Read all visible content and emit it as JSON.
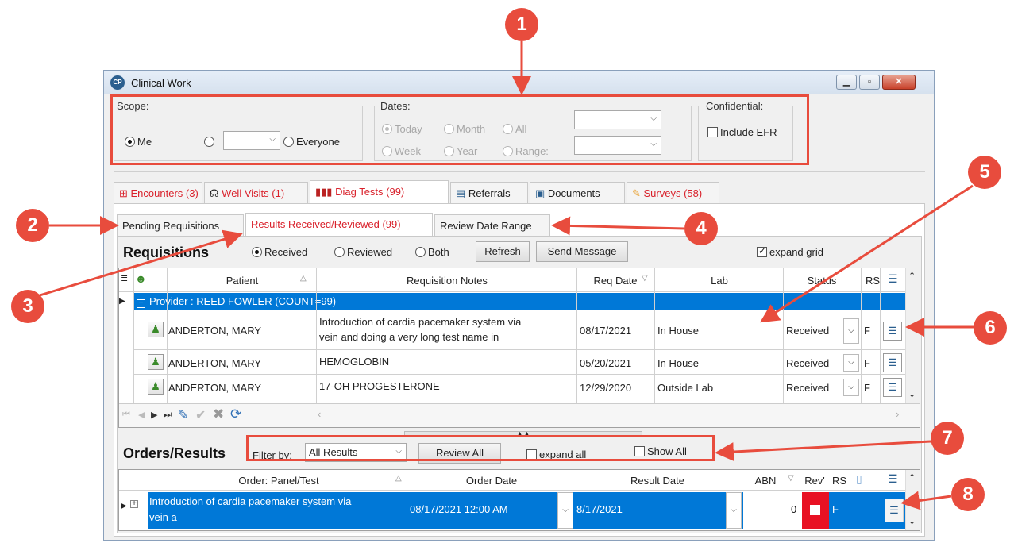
{
  "window": {
    "title": "Clinical Work",
    "icon_text": "CP"
  },
  "scope": {
    "label": "Scope:",
    "me": "Me",
    "everyone": "Everyone"
  },
  "dates": {
    "label": "Dates:",
    "today": "Today",
    "month": "Month",
    "all": "All",
    "week": "Week",
    "year": "Year",
    "range": "Range:"
  },
  "confidential": {
    "label": "Confidential:",
    "include_efr": "Include EFR"
  },
  "main_tabs": [
    {
      "label": "Encounters (3)"
    },
    {
      "label": "Well Visits (1)"
    },
    {
      "label": "Diag Tests (99)"
    },
    {
      "label": "Referrals"
    },
    {
      "label": "Documents"
    },
    {
      "label": "Surveys (58)"
    }
  ],
  "sub_tabs": [
    {
      "label": "Pending Requisitions"
    },
    {
      "label": "Results Received/Reviewed (99)"
    },
    {
      "label": "Review Date Range"
    }
  ],
  "requisitions": {
    "title": "Requisitions",
    "received": "Received",
    "reviewed": "Reviewed",
    "both": "Both",
    "refresh": "Refresh",
    "send_message": "Send Message",
    "expand_grid": "expand grid",
    "columns": {
      "patient": "Patient",
      "notes": "Requisition Notes",
      "req_date": "Req Date",
      "lab": "Lab",
      "status": "Status",
      "rs": "RS"
    },
    "group_row": "Provider : REED FOWLER (COUNT=99)",
    "rows": [
      {
        "patient": "ANDERTON, MARY",
        "notes1": "Introduction of cardia pacemaker system via",
        "notes2": "vein and doing a very long test name in",
        "date": "08/17/2021",
        "lab": "In House",
        "status": "Received",
        "rs": "F"
      },
      {
        "patient": "ANDERTON, MARY",
        "notes1": "HEMOGLOBIN",
        "notes2": "",
        "date": "05/20/2021",
        "lab": "In House",
        "status": "Received",
        "rs": "F"
      },
      {
        "patient": "ANDERTON, MARY",
        "notes1": "17-OH PROGESTERONE",
        "notes2": "",
        "date": "12/29/2020",
        "lab": "Outside Lab",
        "status": "Received",
        "rs": "F"
      }
    ]
  },
  "orders": {
    "title": "Orders/Results",
    "filter_label": "Filter by:",
    "filter_value": "All Results",
    "review_all": "Review All",
    "expand_all": "expand all",
    "show_all": "Show All",
    "columns": {
      "panel": "Order: Panel/Test",
      "order_date": "Order Date",
      "result_date": "Result Date",
      "abn": "ABN",
      "rev": "Rev'",
      "rs": "RS"
    },
    "row": {
      "test1": "Introduction of cardia pacemaker system via",
      "test2": "vein a",
      "order_date": "08/17/2021 12:00 AM",
      "result_date": "8/17/2021",
      "abn": "0",
      "rs": "F"
    }
  },
  "callouts": [
    "1",
    "2",
    "3",
    "4",
    "5",
    "6",
    "7",
    "8"
  ],
  "colors": {
    "accent_red": "#e84c3d",
    "selection_blue": "#0078d7",
    "tab_red": "#d9212b"
  }
}
